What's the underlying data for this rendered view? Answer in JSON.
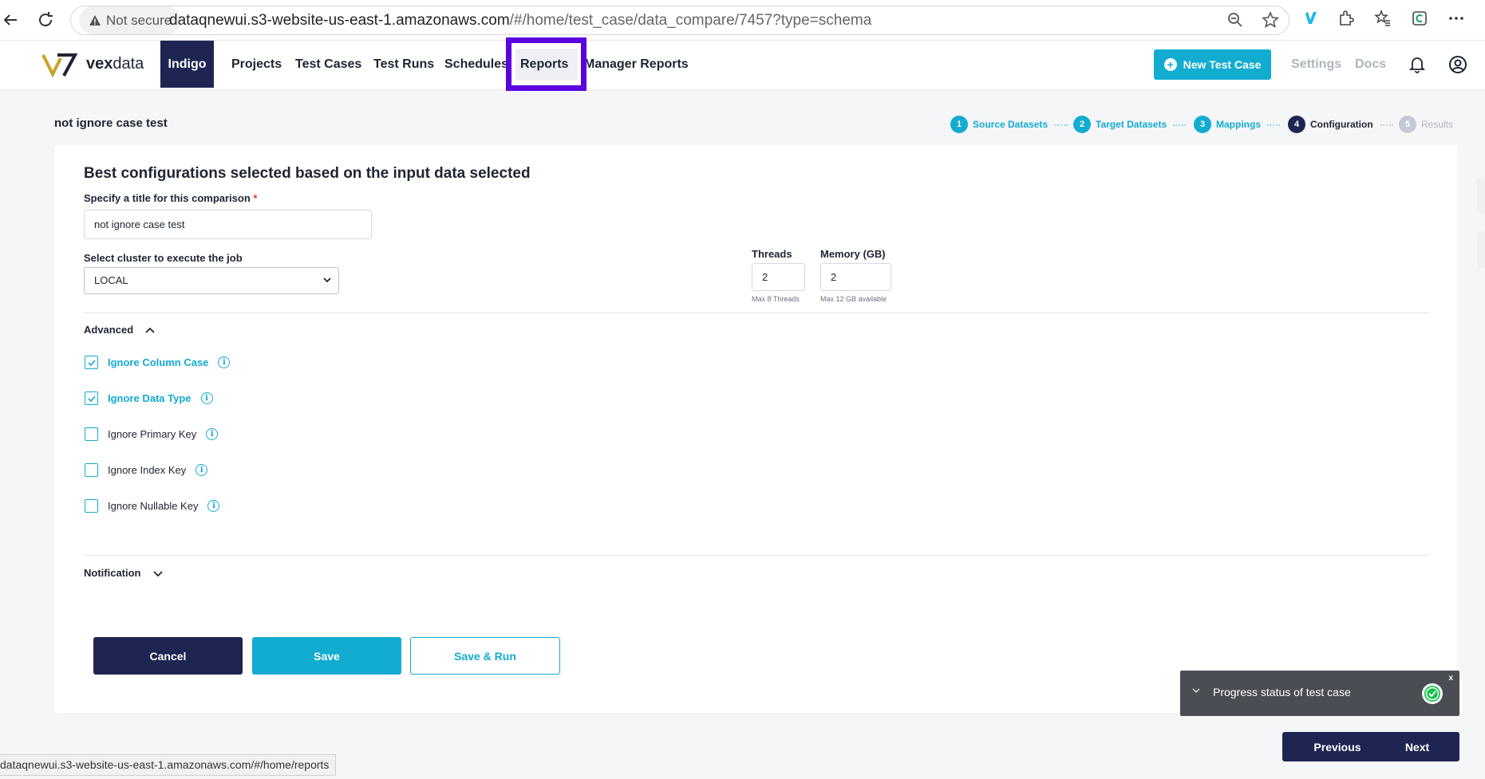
{
  "browser": {
    "not_secure": "Not secure",
    "url_host": "dataqnewui.s3-website-us-east-1.amazonaws.com",
    "url_path": "/#/home/test_case/data_compare/7457?type=schema",
    "status_url": "dataqnewui.s3-website-us-east-1.amazonaws.com/#/home/reports"
  },
  "header": {
    "logo_text_bold": "vex",
    "logo_text": "data",
    "org": "Indigo",
    "menu": [
      "Projects",
      "Test Cases",
      "Test Runs",
      "Schedules",
      "Reports",
      "Manager Reports"
    ],
    "new_test_case": "New Test Case",
    "settings": "Settings",
    "docs": "Docs"
  },
  "page": {
    "title": "not ignore case test",
    "steps": [
      {
        "num": "1",
        "label": "Source Datasets",
        "state": "done"
      },
      {
        "num": "2",
        "label": "Target Datasets",
        "state": "done"
      },
      {
        "num": "3",
        "label": "Mappings",
        "state": "done"
      },
      {
        "num": "4",
        "label": "Configuration",
        "state": "active"
      },
      {
        "num": "5",
        "label": "Results",
        "state": "todo"
      }
    ]
  },
  "form": {
    "heading": "Best configurations selected based on the input data selected",
    "title_label": "Specify a title for this comparison",
    "required_mark": "*",
    "title_value": "not ignore case test",
    "cluster_label": "Select cluster to execute the job",
    "cluster_value": "LOCAL",
    "threads_label": "Threads",
    "threads_value": "2",
    "threads_hint": "Max 8 Threads",
    "memory_label": "Memory (GB)",
    "memory_value": "2",
    "memory_hint": "Max 12 GB available",
    "advanced_label": "Advanced",
    "notification_label": "Notification",
    "options": [
      {
        "label": "Ignore Column Case",
        "checked": true
      },
      {
        "label": "Ignore Data Type",
        "checked": true
      },
      {
        "label": "Ignore Primary Key",
        "checked": false
      },
      {
        "label": "Ignore Index Key",
        "checked": false
      },
      {
        "label": "Ignore Nullable Key",
        "checked": false
      }
    ],
    "info_glyph": "i",
    "cancel": "Cancel",
    "save": "Save",
    "save_run": "Save & Run"
  },
  "toast": {
    "text": "Progress status of test case",
    "close": "x"
  },
  "footer_nav": {
    "previous": "Previous",
    "next": "Next"
  },
  "colors": {
    "accent": "#12acd1",
    "navy": "#1f2553",
    "highlight": "#5b00e0"
  }
}
